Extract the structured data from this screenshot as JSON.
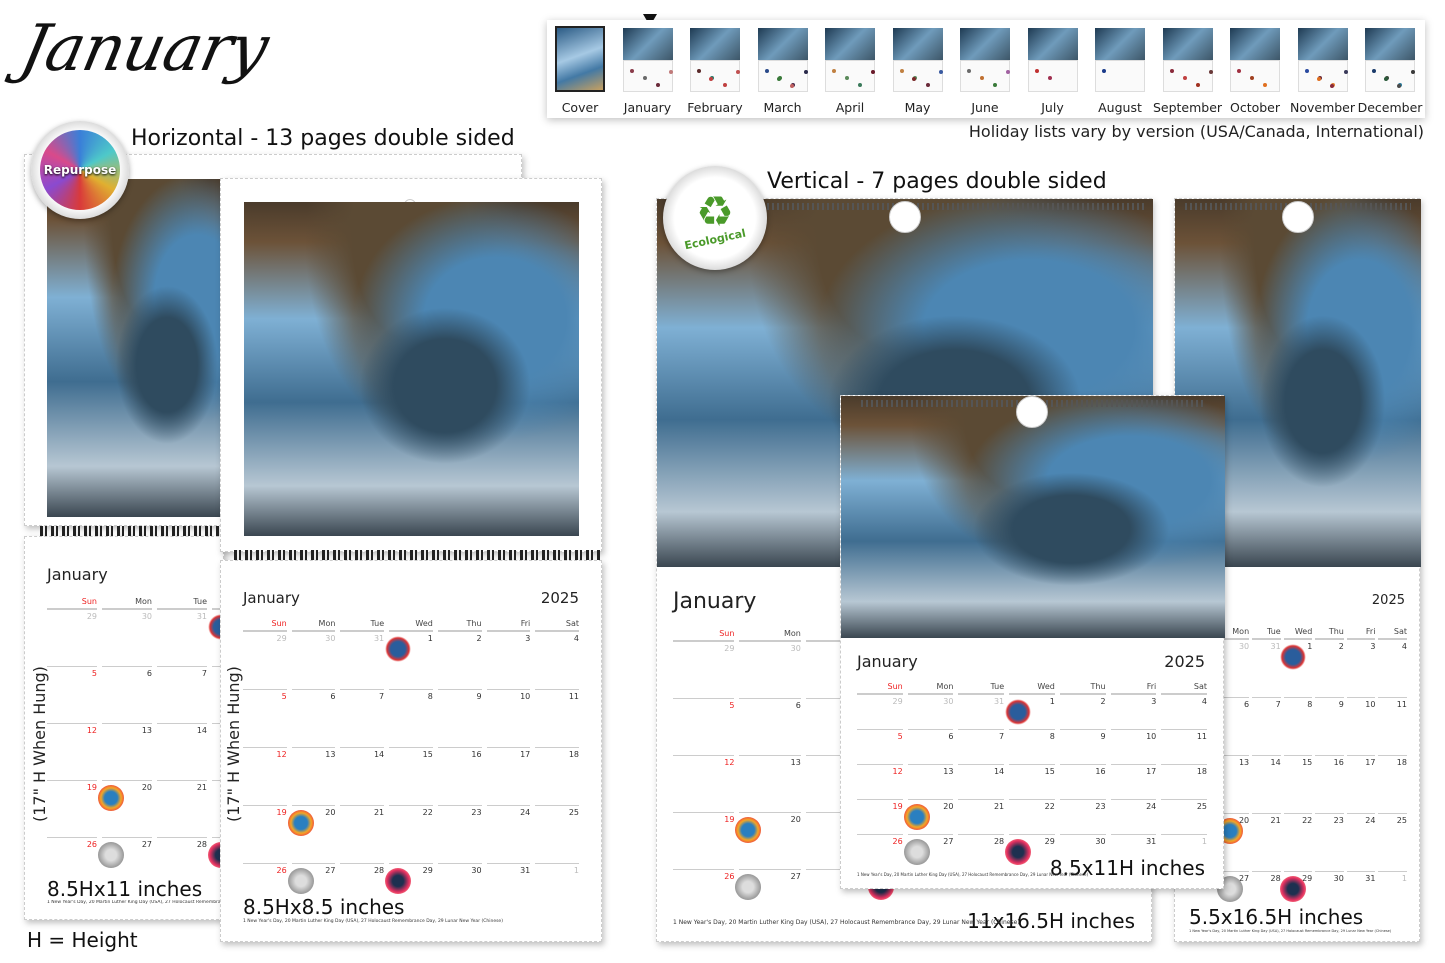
{
  "title": "January",
  "thumbnail_strip": {
    "selected": "January",
    "items": [
      {
        "label": "Cover",
        "dots": []
      },
      {
        "label": "January",
        "dots": [
          "#8a3b4a",
          "#6a6a6a",
          "#6a2a3a",
          "#c07a7a"
        ]
      },
      {
        "label": "February",
        "dots": [
          "#5a2a2a",
          "#2a7a6a",
          "#c04040",
          "#c05050",
          "#c04040"
        ]
      },
      {
        "label": "March",
        "dots": [
          "#2a4a8a",
          "#3a7a3a",
          "#4a2a4a",
          "#2a2a4a",
          "#3a7a3a",
          "#c06060"
        ]
      },
      {
        "label": "April",
        "dots": [
          "#c08040",
          "#5a8a5a",
          "#3a7a5a",
          "#6a1a2a"
        ]
      },
      {
        "label": "May",
        "dots": [
          "#c08040",
          "#5a8a5a",
          "#6a2a3a",
          "#3a5aa0",
          "#7a2a2a"
        ]
      },
      {
        "label": "June",
        "dots": [
          "#6a6a6a",
          "#c07030",
          "#3a7a3a",
          "#a060a0"
        ]
      },
      {
        "label": "July",
        "dots": [
          "#c03030",
          "#a03050"
        ]
      },
      {
        "label": "August",
        "dots": [
          "#1a3a8a"
        ]
      },
      {
        "label": "September",
        "dots": [
          "#8a2a3a",
          "#c04040",
          "#a03020",
          "#6a3a3a"
        ]
      },
      {
        "label": "October",
        "dots": [
          "#a03040",
          "#a04020",
          "#e07020"
        ]
      },
      {
        "label": "November",
        "dots": [
          "#2a4aa0",
          "#6a2a3a",
          "#e08030",
          "#3a3a5a",
          "#e07020",
          "#8a2a3a"
        ]
      },
      {
        "label": "December",
        "dots": [
          "#1a3a6a",
          "#3a4a3a",
          "#2a7a9a",
          "#3a3a3a",
          "#2a5a3a",
          "#4a4a4a"
        ]
      }
    ],
    "note": "Holiday lists vary by version (USA/Canada, International)"
  },
  "horizontal": {
    "heading": "Horizontal - 13 pages double sided",
    "badge": "Repurpose",
    "hung_label": "(17\" H When Hung)",
    "height_legend": "H = Height",
    "sizes": [
      "8.5Hx11 inches",
      "8.5Hx8.5 inches"
    ]
  },
  "vertical": {
    "heading": "Vertical - 7 pages double sided",
    "badge": "Ecological",
    "sizes": [
      "11x16.5H inches",
      "5.5x16.5H inches",
      "8.5x11H inches"
    ]
  },
  "calendar": {
    "month": "January",
    "year": "2025",
    "weekdays": [
      "Sun",
      "Mon",
      "Tue",
      "Wed",
      "Thu",
      "Fri",
      "Sat"
    ],
    "weeks": [
      [
        {
          "d": "29",
          "m": 1
        },
        {
          "d": "30",
          "m": 1
        },
        {
          "d": "31",
          "m": 1
        },
        {
          "d": "1",
          "h": "ny"
        },
        {
          "d": "2"
        },
        {
          "d": "3"
        },
        {
          "d": "4"
        }
      ],
      [
        {
          "d": "5"
        },
        {
          "d": "6"
        },
        {
          "d": "7"
        },
        {
          "d": "8"
        },
        {
          "d": "9"
        },
        {
          "d": "10"
        },
        {
          "d": "11"
        }
      ],
      [
        {
          "d": "12"
        },
        {
          "d": "13"
        },
        {
          "d": "14"
        },
        {
          "d": "15"
        },
        {
          "d": "16"
        },
        {
          "d": "17"
        },
        {
          "d": "18"
        }
      ],
      [
        {
          "d": "19"
        },
        {
          "d": "20",
          "h": "mlk"
        },
        {
          "d": "21"
        },
        {
          "d": "22"
        },
        {
          "d": "23"
        },
        {
          "d": "24"
        },
        {
          "d": "25"
        }
      ],
      [
        {
          "d": "26"
        },
        {
          "d": "27",
          "h": "holo"
        },
        {
          "d": "28"
        },
        {
          "d": "29",
          "h": "lny"
        },
        {
          "d": "30"
        },
        {
          "d": "31"
        },
        {
          "d": "1",
          "m": 1
        }
      ]
    ],
    "holidays_footnote": "1 New Year's Day, 20 Martin Luther King Day (USA), 27 Holocaust Remembrance Day, 29 Lunar New Year (Chinese)"
  },
  "colors": {
    "weekend_red": "#e22222",
    "muted_day": "#bbbbbb",
    "badge_green": "#4a9a2a"
  }
}
